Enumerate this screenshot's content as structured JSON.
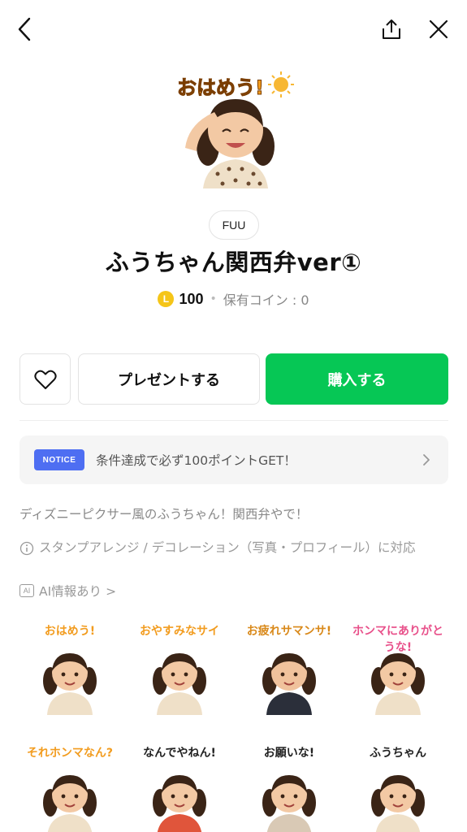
{
  "topbar": {
    "back_icon": "chevron-left-icon",
    "share_icon": "share-icon",
    "close_icon": "close-icon"
  },
  "hero": {
    "caption": "おはめう!"
  },
  "author": "FUU",
  "title": "ふうちゃん関西弁ver①",
  "price": {
    "coin_letter": "L",
    "value": "100",
    "separator": "•",
    "owned": "保有コイン : 0"
  },
  "actions": {
    "like_icon": "heart-outline-icon",
    "gift_label": "プレゼントする",
    "buy_label": "購入する",
    "buy_color": "#06c755"
  },
  "notice": {
    "badge": "NOTICE",
    "text": "条件達成で必ず100ポイントGET！",
    "badge_color": "#4e6ef2"
  },
  "description": "ディズニーピクサー風のふうちゃん！関西弁やで！",
  "arrange": "スタンプアレンジ / デコレーション（写真・プロフィール）に対応",
  "ai": {
    "badge": "AI",
    "label": "AI情報あり >"
  },
  "stickers": [
    {
      "caption": "おはめう!",
      "color": "#f29c1f"
    },
    {
      "caption": "おやすみなサイ",
      "color": "#f29c1f"
    },
    {
      "caption": "お疲れサマンサ!",
      "color": "#d9891a"
    },
    {
      "caption": "ホンマにありがとうな!",
      "color": "#e8508a"
    },
    {
      "caption": "それホンマなん?",
      "color": "#f29c1f"
    },
    {
      "caption": "なんでやねん!",
      "color": "#222222"
    },
    {
      "caption": "お願いな!",
      "color": "#222222"
    },
    {
      "caption": "ふうちゃん",
      "color": "#222222"
    }
  ]
}
